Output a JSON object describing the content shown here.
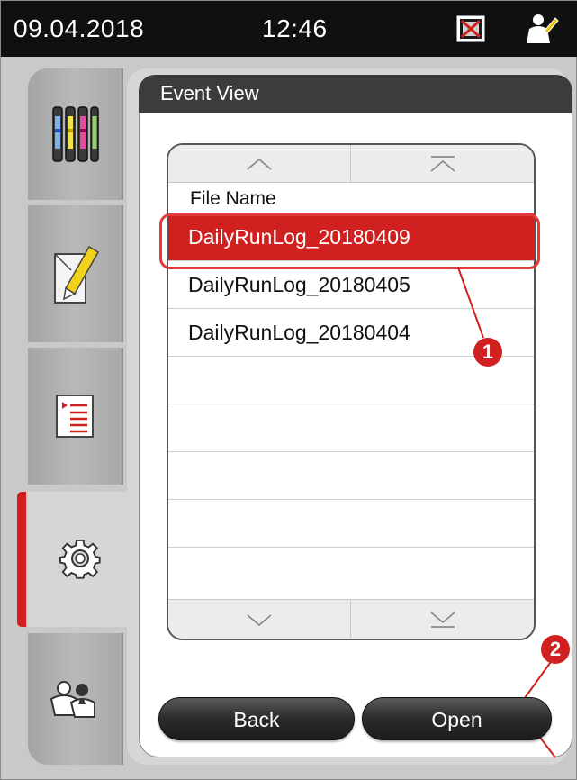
{
  "status": {
    "date": "09.04.2018",
    "time": "12:46",
    "network_icon": "network-error-icon",
    "user_icon": "user-icon"
  },
  "sidebar": {
    "items": [
      {
        "id": "reagents",
        "icon": "reagent-vials-icon"
      },
      {
        "id": "edit",
        "icon": "edit-note-icon"
      },
      {
        "id": "programs",
        "icon": "program-list-icon"
      },
      {
        "id": "settings",
        "icon": "gear-icon",
        "selected": true
      },
      {
        "id": "users",
        "icon": "users-icon"
      }
    ]
  },
  "panel": {
    "title": "Event View"
  },
  "list": {
    "column_header": "File Name",
    "rows": [
      {
        "name": "DailyRunLog_20180409",
        "selected": true
      },
      {
        "name": "DailyRunLog_20180405",
        "selected": false
      },
      {
        "name": "DailyRunLog_20180404",
        "selected": false
      },
      {
        "name": "",
        "selected": false
      },
      {
        "name": "",
        "selected": false
      },
      {
        "name": "",
        "selected": false
      },
      {
        "name": "",
        "selected": false
      },
      {
        "name": "",
        "selected": false
      }
    ]
  },
  "callouts": {
    "one": "1",
    "two": "2"
  },
  "buttons": {
    "back": "Back",
    "open": "Open"
  },
  "colors": {
    "accent": "#d0201f",
    "statusbar": "#101010",
    "titlebar": "#3c3c3c"
  }
}
